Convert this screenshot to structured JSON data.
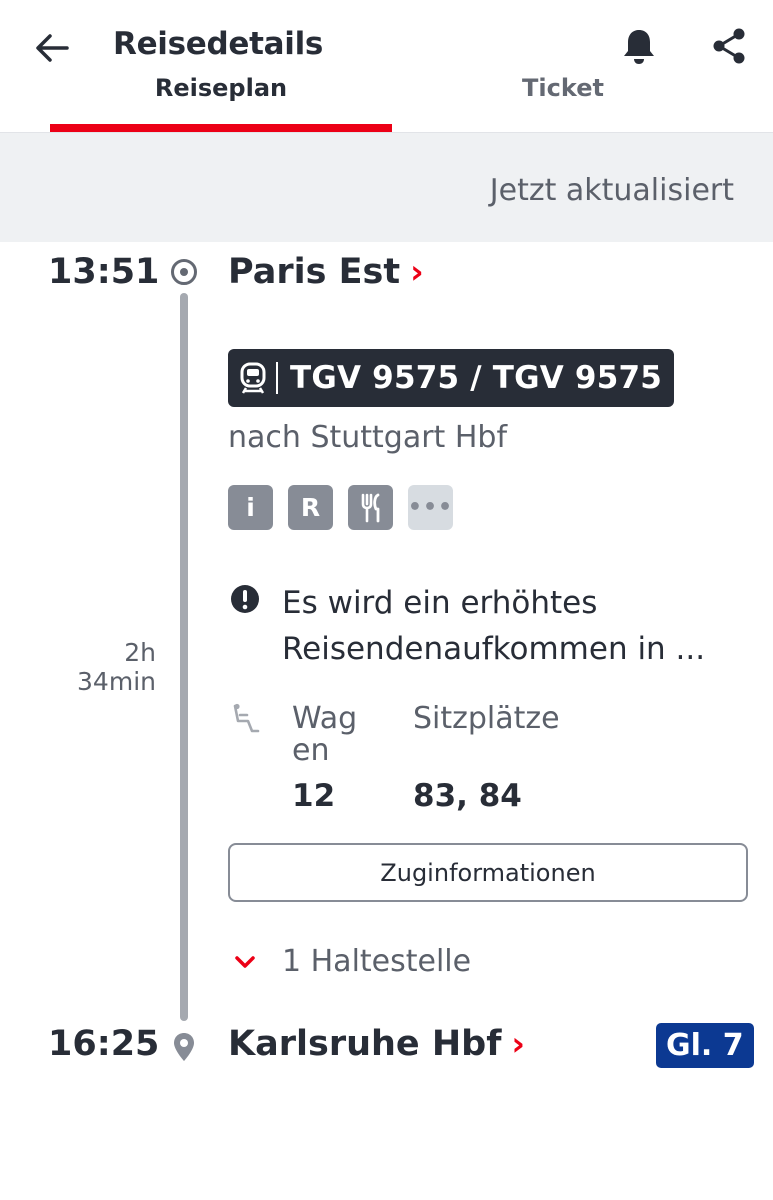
{
  "header": {
    "title": "Reisedetails",
    "back_icon": "arrow-left-icon",
    "bell_icon": "bell-icon",
    "share_icon": "share-icon"
  },
  "tabs": [
    {
      "label": "Reiseplan",
      "active": true
    },
    {
      "label": "Ticket",
      "active": false
    }
  ],
  "accent_color": "#ec0016",
  "refresh": {
    "text": "Jetzt aktualisiert"
  },
  "departure": {
    "time": "13:51",
    "station": "Paris Est",
    "chevron": "›"
  },
  "duration": {
    "hours": "2h",
    "minutes": "34min"
  },
  "train": {
    "icon": "train-front-icon",
    "name": "TGV 9575 / TGV 9575",
    "direction": "nach Stuttgart Hbf"
  },
  "amenities": [
    {
      "icon": "info-icon",
      "label": "i"
    },
    {
      "icon": "reservation-icon",
      "label": "R"
    },
    {
      "icon": "restaurant-icon",
      "label": ""
    },
    {
      "icon": "more-icon",
      "label": "•••"
    }
  ],
  "warning": {
    "icon": "alert-circle-icon",
    "text": "Es wird ein erhöhtes Reisendenaufkommen in ..."
  },
  "reservation": {
    "icon": "seat-icon",
    "wagen_label": "Wagen",
    "wagen_value": "12",
    "seats_label": "Sitzplätze",
    "seats_value": "83, 84"
  },
  "train_info_button": "Zuginformationen",
  "stops": {
    "icon": "chevron-down-icon",
    "text": "1 Haltestelle"
  },
  "arrival": {
    "time": "16:25",
    "station": "Karlsruhe Hbf",
    "chevron": "›",
    "platform": "Gl. 7"
  },
  "platform_color": "#0c3992"
}
